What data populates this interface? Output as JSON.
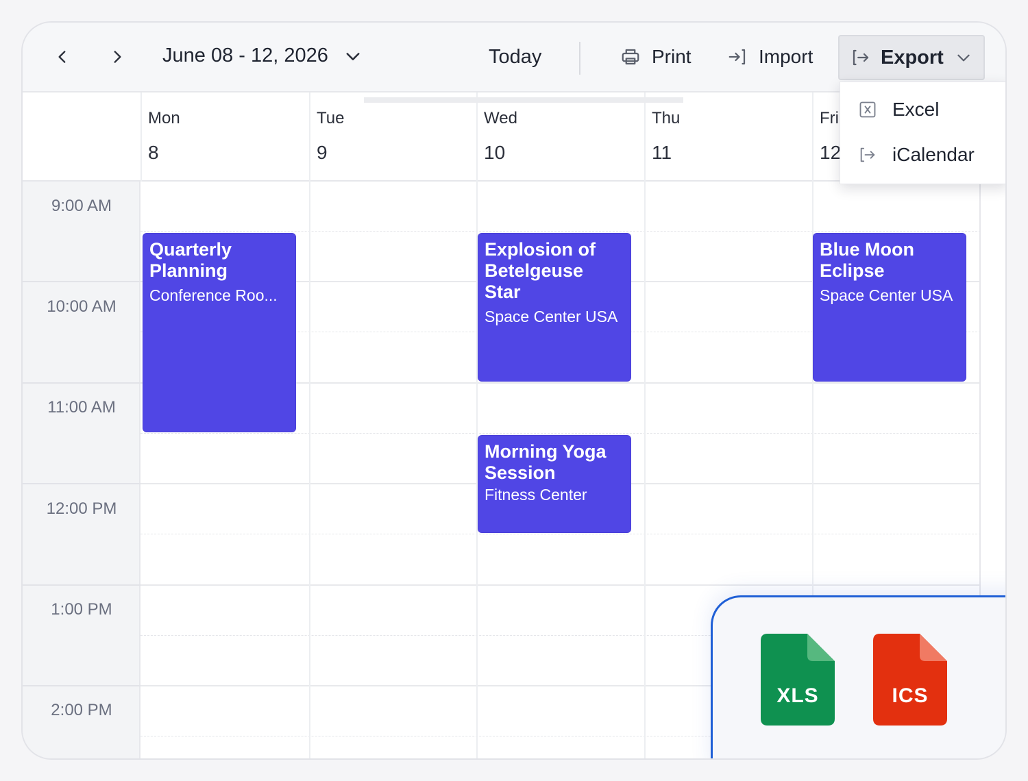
{
  "toolbar": {
    "date_range": "June 08 - 12, 2026",
    "today_label": "Today",
    "print_label": "Print",
    "import_label": "Import",
    "export_label": "Export"
  },
  "days": [
    {
      "name": "Mon",
      "date": "8"
    },
    {
      "name": "Tue",
      "date": "9"
    },
    {
      "name": "Wed",
      "date": "10"
    },
    {
      "name": "Thu",
      "date": "11"
    },
    {
      "name": "Fri",
      "date": "12"
    }
  ],
  "time_slots": [
    "9:00 AM",
    "10:00 AM",
    "11:00 AM",
    "12:00 PM",
    "1:00 PM",
    "2:00 PM"
  ],
  "events": [
    {
      "title": "Quarterly Planning",
      "location": "Conference Roo..."
    },
    {
      "title": "Explosion of Betelgeuse Star",
      "location": "Space Center USA"
    },
    {
      "title": "Blue Moon Eclipse",
      "location": "Space Center USA"
    },
    {
      "title": "Morning Yoga Session",
      "location": "Fitness Center"
    }
  ],
  "export_menu": {
    "items": [
      {
        "label": "Excel",
        "icon": "excel-icon"
      },
      {
        "label": "iCalendar",
        "icon": "export-icon"
      }
    ]
  },
  "export_formats": [
    {
      "label": "XLS",
      "color": "#0f9150"
    },
    {
      "label": "ICS",
      "color": "#e3300f"
    }
  ],
  "colors": {
    "event": "#5046e5",
    "accent_border": "#1f5fd6"
  }
}
